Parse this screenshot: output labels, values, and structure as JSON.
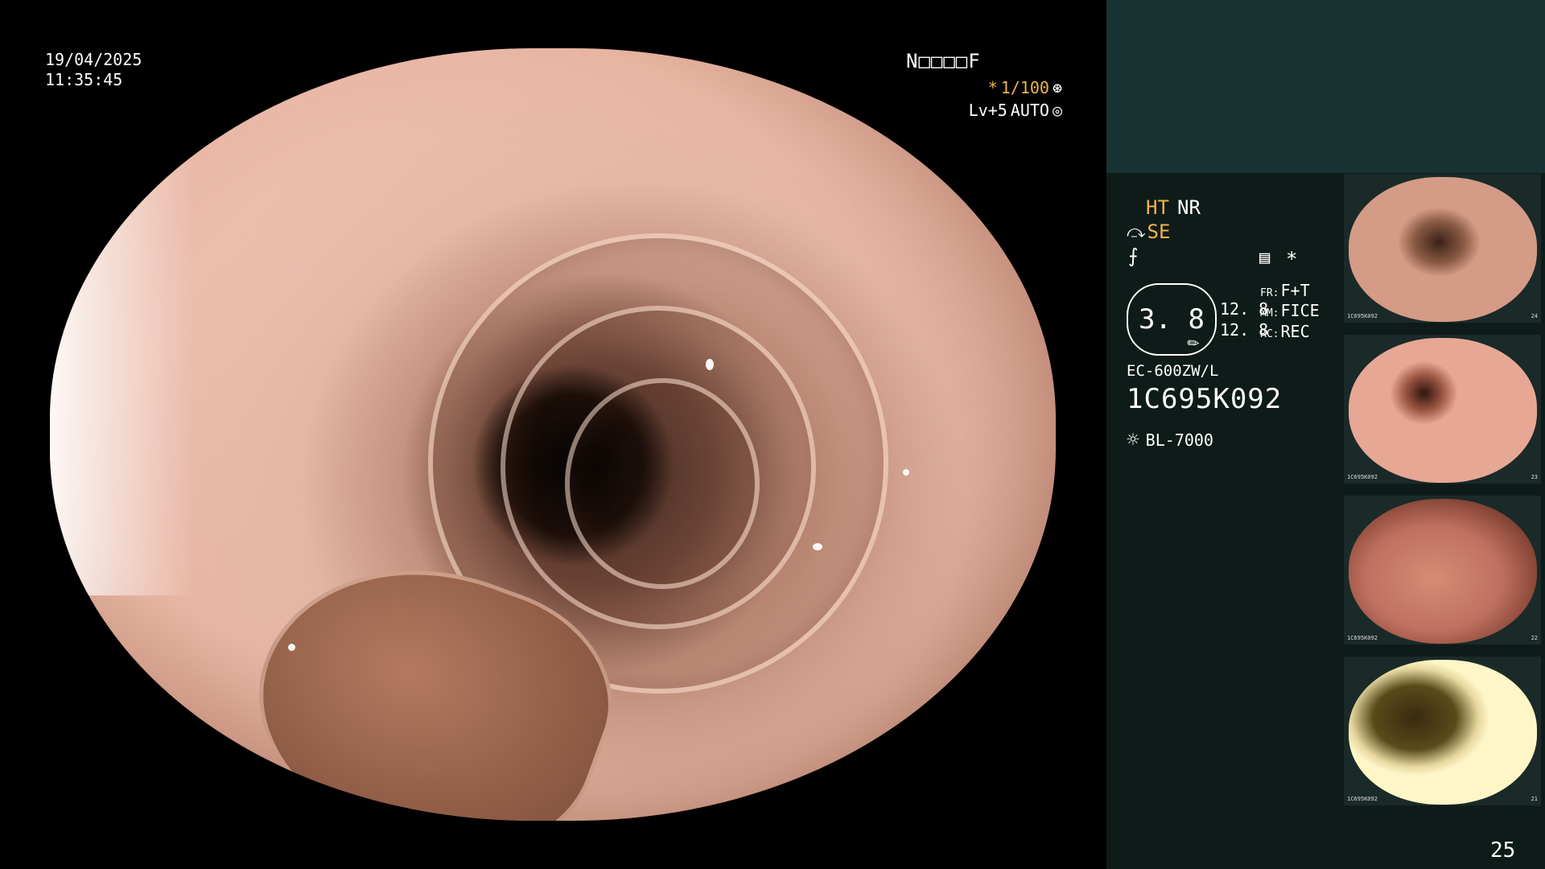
{
  "overlay": {
    "date": "19/04/2025",
    "time": "11:35:45",
    "status_code": "N□□□□F",
    "shutter_prefix": "*",
    "shutter_value": "1/100",
    "shutter_icon": "aperture-icon",
    "level": "Lv+5",
    "level_mode": "AUTO",
    "level_icon": "iris-icon"
  },
  "panel": {
    "mode_ht": "HT",
    "mode_nr": "NR",
    "se_icon": "scope-curve-icon",
    "se_label": "SE",
    "f_icon": "freeze-icon",
    "grid_icon": "memory-grid-icon",
    "star_icon": "asterisk-icon",
    "gauge_value": "3. 8",
    "gauge_r1": "12. 8",
    "gauge_r2": "12. 8",
    "fr_label": "FR:",
    "fr_value": "F+T",
    "mm_label": "MM:",
    "mm_value": "FICE",
    "rc_label": "RC:",
    "rc_value": "REC",
    "model": "EC-600ZW/L",
    "serial": "1C695K092",
    "light_icon": "lamp-icon",
    "light_source": "BL-7000",
    "page_number": "25"
  },
  "thumbnails": [
    {
      "caption": "1C695K092",
      "count": "24"
    },
    {
      "caption": "1C695K092",
      "count": "23"
    },
    {
      "caption": "1C695K092",
      "count": "22"
    },
    {
      "caption": "1C695K092",
      "count": "21"
    }
  ]
}
